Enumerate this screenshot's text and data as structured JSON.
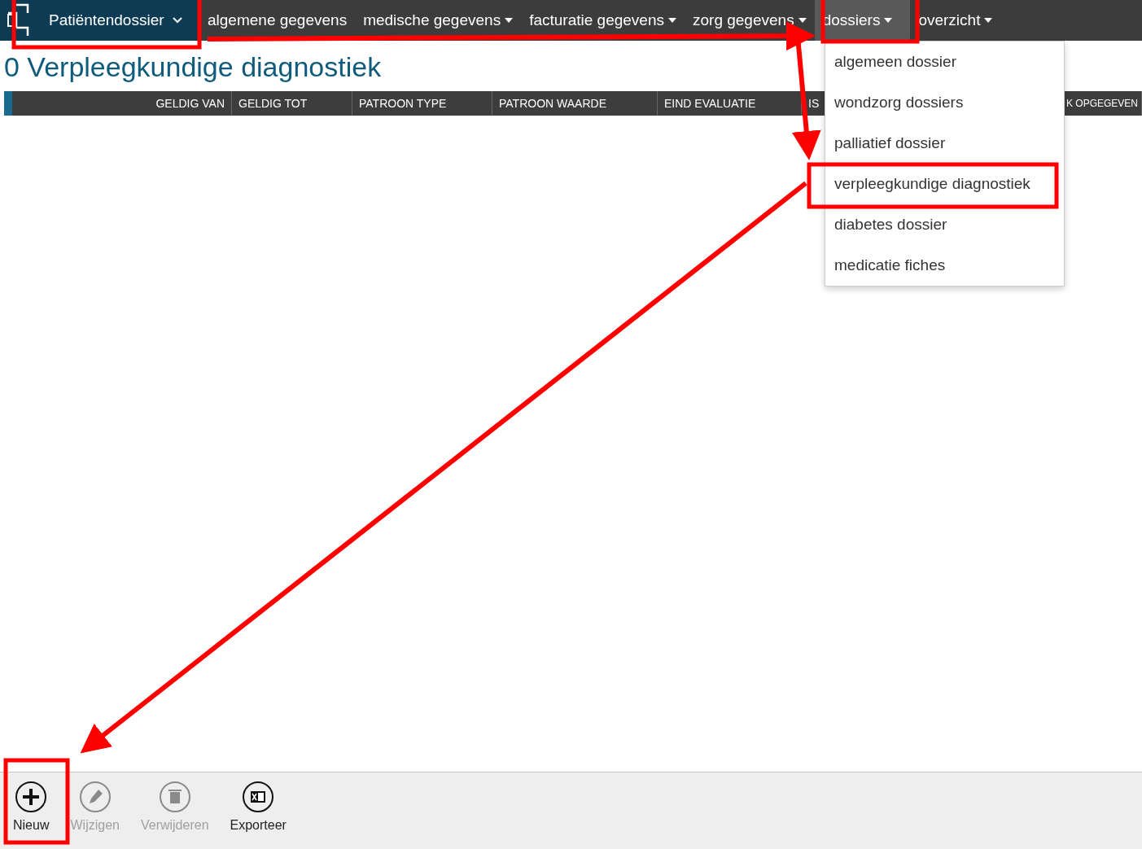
{
  "navbar": {
    "brand": {
      "label": "Patiëntendossier"
    },
    "items": [
      {
        "label": "algemene gegevens",
        "has_menu": false,
        "selected": false
      },
      {
        "label": "medische gegevens",
        "has_menu": true,
        "selected": false
      },
      {
        "label": "facturatie gegevens",
        "has_menu": true,
        "selected": false
      },
      {
        "label": "zorg gegevens",
        "has_menu": true,
        "selected": false
      },
      {
        "label": "dossiers",
        "has_menu": true,
        "selected": true
      },
      {
        "label": "overzicht",
        "has_menu": true,
        "selected": false
      }
    ]
  },
  "dropdown": {
    "items": [
      {
        "label": "algemeen dossier"
      },
      {
        "label": "wondzorg dossiers"
      },
      {
        "label": "palliatief dossier"
      },
      {
        "label": "verpleegkundige diagnostiek"
      },
      {
        "label": "diabetes dossier"
      },
      {
        "label": "medicatie fiches"
      }
    ]
  },
  "page_title": "0 Verpleegkundige diagnostiek",
  "table": {
    "columns": [
      "GELDIG VAN",
      "GELDIG TOT",
      "PATROON TYPE",
      "PATROON WAARDE",
      "EIND EVALUATIE",
      "IS",
      "K OPGEGEVEN"
    ]
  },
  "toolbar": [
    {
      "kind": "add",
      "label": "Nieuw",
      "disabled": false
    },
    {
      "kind": "edit",
      "label": "Wijzigen",
      "disabled": true
    },
    {
      "kind": "delete",
      "label": "Verwijderen",
      "disabled": true
    },
    {
      "kind": "export",
      "label": "Exporteer",
      "disabled": false
    }
  ]
}
